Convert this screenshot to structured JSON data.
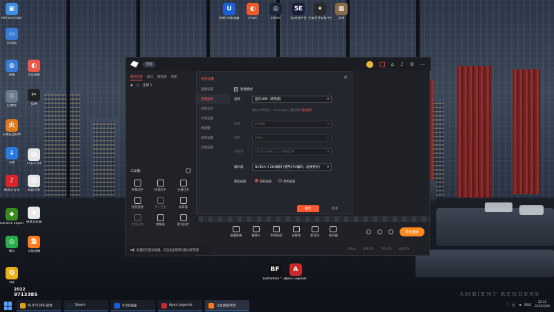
{
  "desktop_icons": [
    {
      "label": "Administrator",
      "color": "#3d8ee0",
      "glyph": "▣"
    },
    {
      "label": "此电脑",
      "color": "#3a7bd5",
      "glyph": "▭"
    },
    {
      "label": "网络",
      "color": "#3a7bd5",
      "glyph": "◍"
    },
    {
      "label": "回收站",
      "color": "#6b7a8f",
      "glyph": "♲"
    },
    {
      "label": "火绒安全软件",
      "color": "#e07a1f",
      "glyph": "火"
    },
    {
      "label": "迅雷",
      "color": "#2a7ae2",
      "glyph": "↓"
    },
    {
      "label": "网易云音乐",
      "color": "#d9262b",
      "glyph": "♪"
    },
    {
      "label": "GeForce Experience",
      "color": "#3b8a1e",
      "glyph": "◆"
    },
    {
      "label": "微信",
      "color": "#2aae4b",
      "glyph": "◎"
    },
    {
      "label": "QQ",
      "color": "#e8b11c",
      "glyph": "Q"
    },
    {
      "label": "百度网盘",
      "color": "#e55a4a",
      "glyph": "◐"
    },
    {
      "label": "剪映",
      "color": "#222222",
      "glyph": "✂"
    },
    {
      "label": "CSGO.txt",
      "color": "#e6e6e6",
      "glyph": "▤"
    },
    {
      "label": "新建文本",
      "color": "#e6e6e6",
      "glyph": "▤"
    },
    {
      "label": "谷歌浏览器",
      "color": "#e8e8e8",
      "glyph": "◉"
    },
    {
      "label": "斗鱼直播",
      "color": "#ff7a1a",
      "glyph": "鱼"
    },
    {
      "label": "网易UU加速器",
      "color": "#1b60d6",
      "glyph": "U"
    },
    {
      "label": "Origin",
      "color": "#f05a28",
      "glyph": "◐"
    },
    {
      "label": "Steam",
      "color": "#1b2838",
      "glyph": "◎"
    },
    {
      "label": "5E对战平台",
      "color": "#1b1b3a",
      "glyph": "5E"
    },
    {
      "label": "完美世界竞技平台",
      "color": "#2a2a2a",
      "glyph": "✦"
    },
    {
      "label": "游戏",
      "color": "#8a6a4a",
      "glyph": "▦"
    },
    {
      "label": "Battlefield™ 2042 Ope...",
      "color": "#111111",
      "glyph": "BF"
    },
    {
      "label": "Apex Legends",
      "color": "#c62b2b",
      "glyph": "A"
    }
  ],
  "app": {
    "version_badge": "新版",
    "scene_tabs": [
      "我的场景",
      "窗口",
      "游戏源",
      "场景"
    ],
    "source_item": "全屏 1",
    "tools_title": "工具箱",
    "tools_more": "···",
    "tools": [
      {
        "label": "弹幕助手",
        "dim": false
      },
      {
        "label": "房管助手",
        "dim": false
      },
      {
        "label": "主播任务",
        "dim": false
      },
      {
        "label": "视频直播",
        "dim": false
      },
      {
        "label": "多人连麦",
        "dim": true
      },
      {
        "label": "录屏器",
        "dim": false
      },
      {
        "label": "虚拟形象",
        "dim": true
      },
      {
        "label": "弹幕箱",
        "dim": false
      },
      {
        "label": "歌词同步",
        "dim": false
      }
    ],
    "notice": "直播后百度加速器，点击会出现新功能与新官网",
    "controls": [
      "直播屏幕",
      "摄像头",
      "手机投屏",
      "多媒体",
      "麦克风",
      "扬声器"
    ],
    "start_button": "开始直播",
    "stats": [
      "0kbps",
      "丢帧:0%",
      "CPU:0%",
      "内存:0%"
    ]
  },
  "dialog": {
    "title": "系统设置",
    "close": "✕",
    "nav": [
      "直播设置",
      "直播画质",
      "内容显示",
      "声音设置",
      "快捷键",
      "帧率设置",
      "其他设置"
    ],
    "nav_active_index": 1,
    "smart_mode_label": "智能模式",
    "smart_mode_checked": true,
    "rows": [
      {
        "key": "画质",
        "value": "蓝光10M（原性能）",
        "dim": false
      },
      {
        "key": "码率",
        "value": "10000",
        "dim": true
      },
      {
        "key": "帧率",
        "value": "60fps",
        "dim": true
      },
      {
        "key": "分辨率",
        "value": "1920*1080 (1:1) 原始比例",
        "dim": true
      }
    ],
    "hint_text": "您的上传带宽为：50100kbps，建议选择",
    "hint_highlight": "智能画质",
    "encoder_label": "编码器",
    "encoder_value": "NVIDIA H.264编码 (使用CPU编码，画质更好)",
    "output_label": "输出画面",
    "output_options": [
      {
        "label": "游戏画面",
        "selected": true
      },
      {
        "label": "原始画面",
        "selected": false
      }
    ],
    "ok_button": "确定",
    "cancel_button": "取消"
  },
  "badge": {
    "top": "2022",
    "number": "9713385"
  },
  "taskbar": {
    "items": [
      {
        "label": "41975186-游戏",
        "color": "#d9a21c",
        "active": false
      },
      {
        "label": "Steam",
        "color": "#1b2838",
        "active": false
      },
      {
        "label": "UU加速器",
        "color": "#1b60d6",
        "active": false
      },
      {
        "label": "Apex Legends",
        "color": "#c62b2b",
        "active": false
      },
      {
        "label": "斗鱼直播伴侣",
        "color": "#ff7a1a",
        "active": true
      }
    ],
    "lang": "ENG",
    "time": "22:33",
    "date": "2022/2/20"
  },
  "watermark": "AMBIENT RENDERS"
}
